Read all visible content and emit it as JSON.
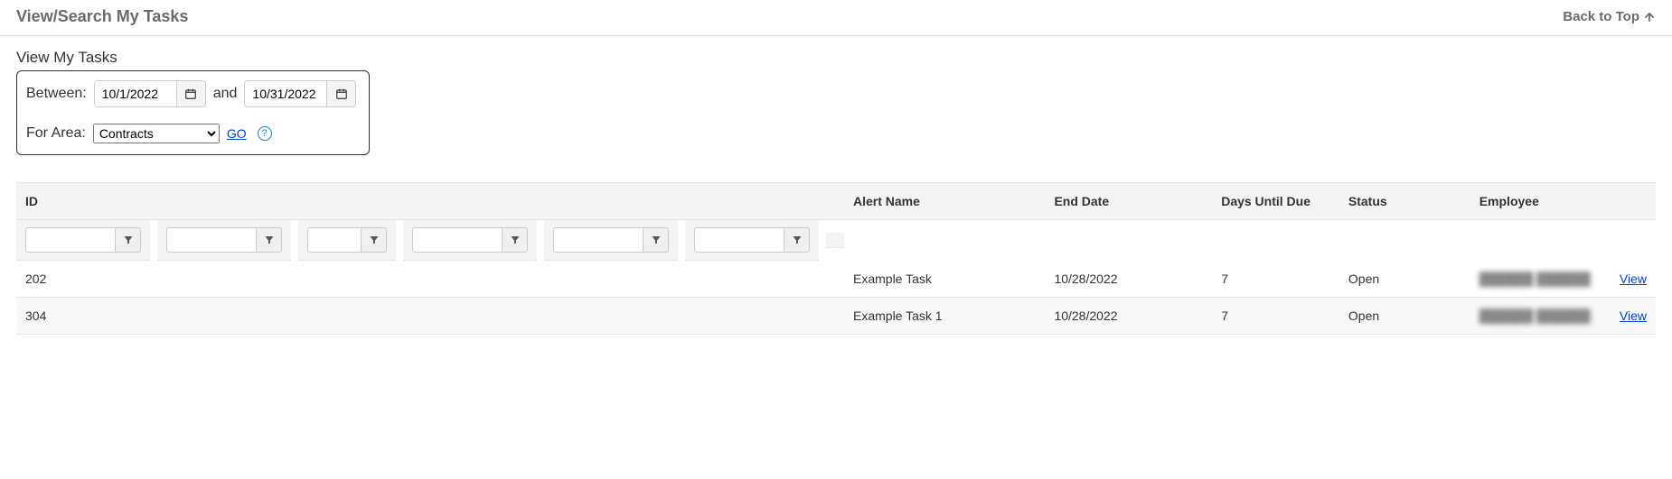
{
  "header": {
    "title": "View/Search My Tasks",
    "back_to_top": "Back to Top"
  },
  "filter": {
    "section_title": "View My Tasks",
    "between_label": "Between:",
    "and_label": "and",
    "date_from": "10/1/2022",
    "date_to": "10/31/2022",
    "for_area_label": "For Area:",
    "area_selected": "Contracts",
    "go_label": "GO",
    "help_glyph": "?"
  },
  "table": {
    "columns": {
      "id": "ID",
      "alert_name": "Alert Name",
      "end_date": "End Date",
      "days_until_due": "Days Until Due",
      "status": "Status",
      "employee": "Employee"
    },
    "view_label": "View",
    "rows": [
      {
        "id": "202",
        "alert_name": "Example Task",
        "end_date": "10/28/2022",
        "days_until_due": "7",
        "status": "Open",
        "employee": "██████ ██████"
      },
      {
        "id": "304",
        "alert_name": "Example Task 1",
        "end_date": "10/28/2022",
        "days_until_due": "7",
        "status": "Open",
        "employee": "██████ ██████"
      }
    ]
  }
}
